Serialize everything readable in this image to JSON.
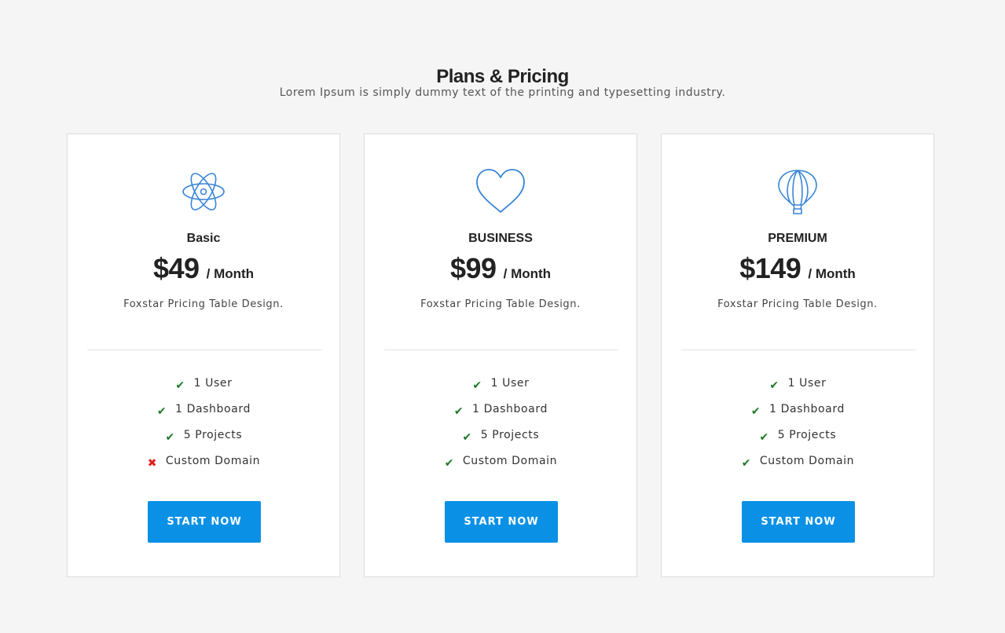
{
  "header": {
    "title": "Plans & Pricing",
    "subtitle": "Lorem Ipsum is simply dummy text of the printing and typesetting industry."
  },
  "colors": {
    "accent": "#0a91e6",
    "icon": "#3a85d6",
    "check": "#1e7a28",
    "cross": "#e0201c"
  },
  "plans": [
    {
      "icon": "atom-icon",
      "name": "Basic",
      "price": "$49",
      "period": "/ Month",
      "tagline": "Foxstar Pricing Table Design.",
      "features": [
        {
          "label": "1 User",
          "included": true,
          "mark": "✔"
        },
        {
          "label": "1 Dashboard",
          "included": true,
          "mark": "✔"
        },
        {
          "label": "5 Projects",
          "included": true,
          "mark": "✔"
        },
        {
          "label": "Custom Domain",
          "included": false,
          "mark": "✖"
        }
      ],
      "cta": "START NOW"
    },
    {
      "icon": "heart-icon",
      "name": "BUSINESS",
      "price": "$99",
      "period": "/ Month",
      "tagline": "Foxstar Pricing Table Design.",
      "features": [
        {
          "label": "1 User",
          "included": true,
          "mark": "✔"
        },
        {
          "label": "1 Dashboard",
          "included": true,
          "mark": "✔"
        },
        {
          "label": "5 Projects",
          "included": true,
          "mark": "✔"
        },
        {
          "label": "Custom Domain",
          "included": true,
          "mark": "✔"
        }
      ],
      "cta": "START NOW"
    },
    {
      "icon": "hot-air-balloon-icon",
      "name": "PREMIUM",
      "price": "$149",
      "period": "/ Month",
      "tagline": "Foxstar Pricing Table Design.",
      "features": [
        {
          "label": "1 User",
          "included": true,
          "mark": "✔"
        },
        {
          "label": "1 Dashboard",
          "included": true,
          "mark": "✔"
        },
        {
          "label": "5 Projects",
          "included": true,
          "mark": "✔"
        },
        {
          "label": "Custom Domain",
          "included": true,
          "mark": "✔"
        }
      ],
      "cta": "START NOW"
    }
  ]
}
